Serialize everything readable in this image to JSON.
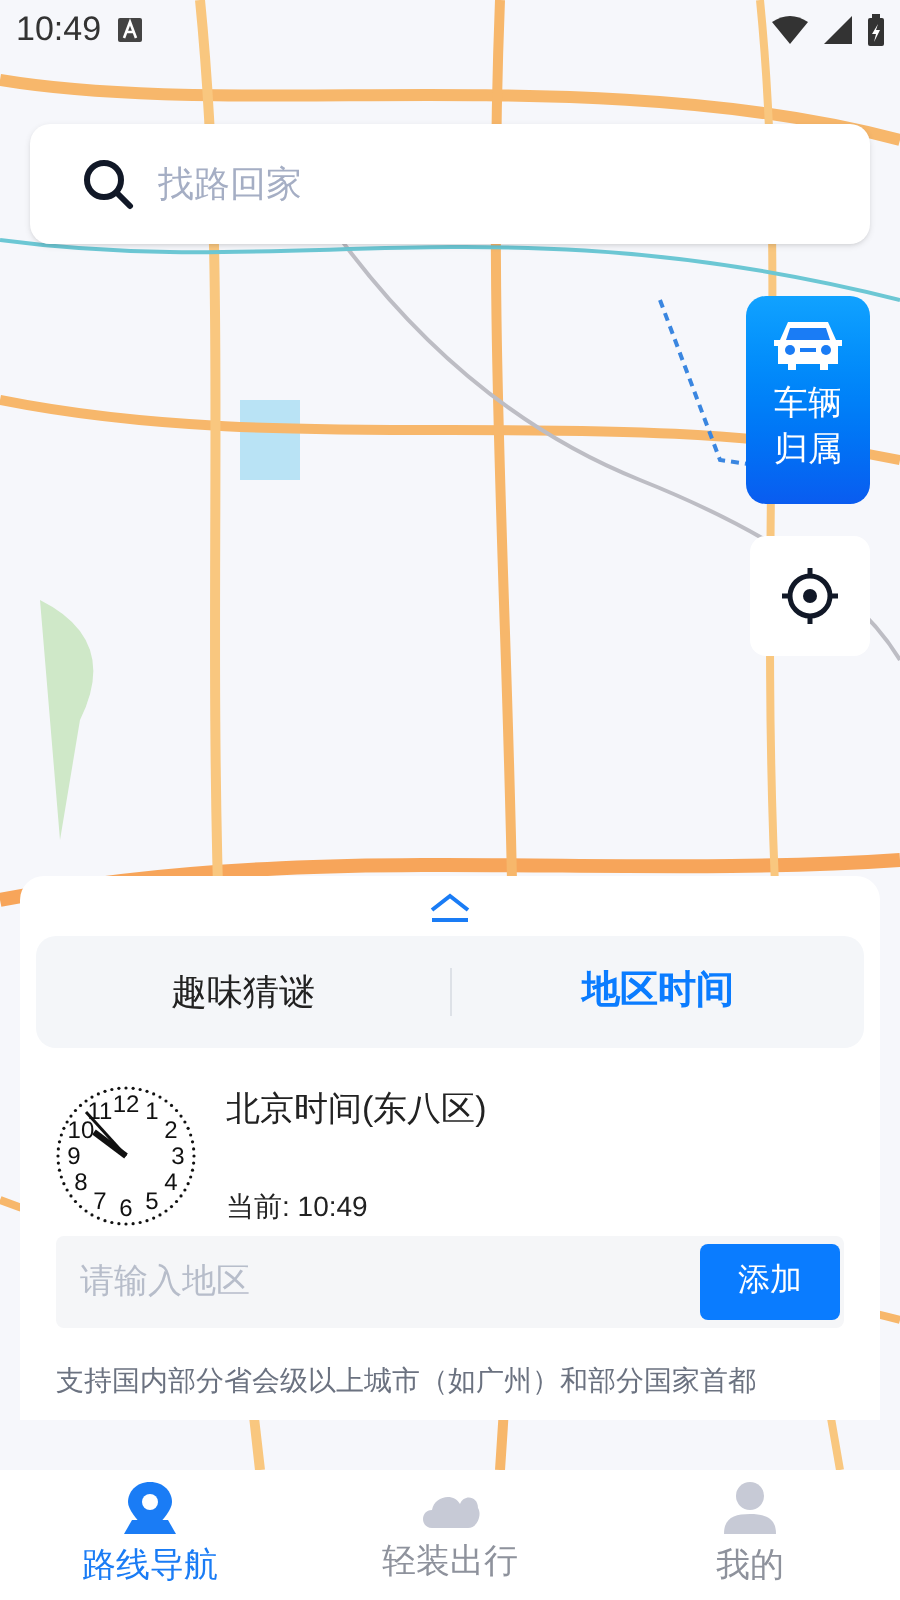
{
  "status_bar": {
    "time": "10:49"
  },
  "search": {
    "placeholder": "找路回家"
  },
  "vehicle_button": {
    "label": "车辆归属"
  },
  "panel": {
    "tabs": [
      {
        "label": "趣味猜谜",
        "selected": false
      },
      {
        "label": "地区时间",
        "selected": true
      }
    ],
    "clock": {
      "numerals": [
        "11",
        "12",
        "1",
        "10",
        "2",
        "9",
        "3",
        "8",
        "4",
        "7",
        "6",
        "5"
      ],
      "zone": "北京时间(东八区)",
      "current": "当前: 10:49"
    },
    "region_input": {
      "placeholder": "请输入地区"
    },
    "add_button": "添加",
    "note": "支持国内部分省会级以上城市（如广州）和部分国家首都"
  },
  "bottom_nav": [
    {
      "kind": "pin",
      "label": "路线导航",
      "selected": true
    },
    {
      "kind": "cloud",
      "label": "轻装出行",
      "selected": false
    },
    {
      "kind": "person",
      "label": "我的",
      "selected": false
    }
  ]
}
